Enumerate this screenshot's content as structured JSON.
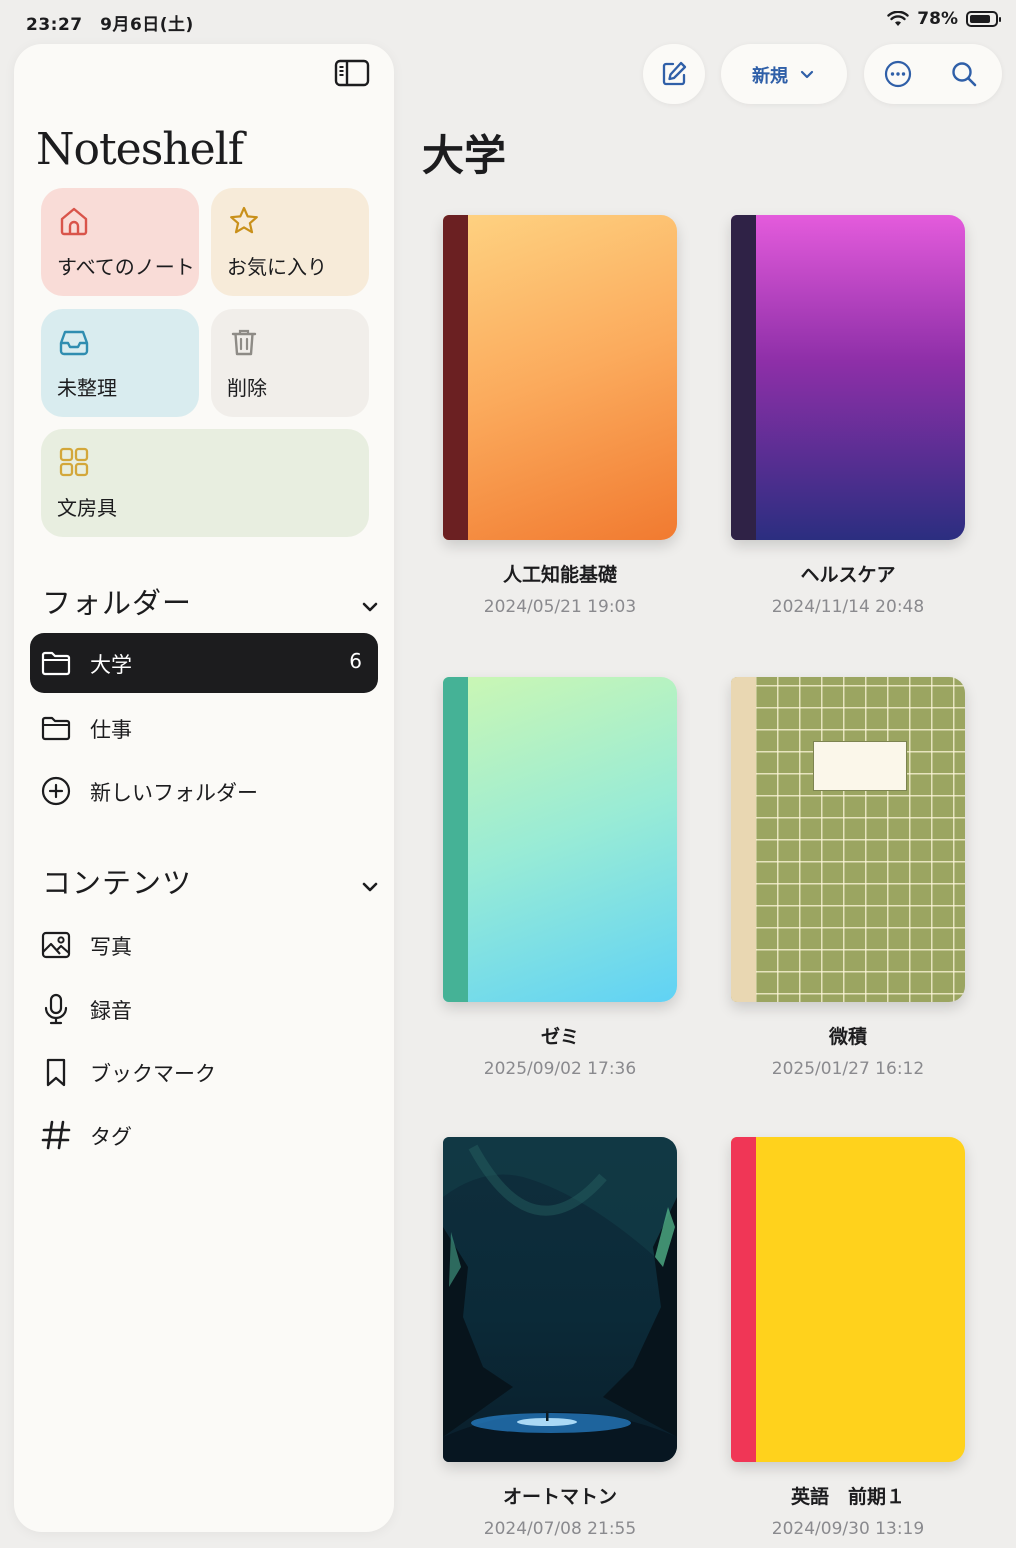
{
  "status_bar": {
    "time": "23:27　9月6日(土)",
    "battery": "78%"
  },
  "sidebar": {
    "app_title": "Noteshelf",
    "tiles": {
      "all_notes": "すべてのノート",
      "favorites": "お気に入り",
      "unfiled": "未整理",
      "trash": "削除",
      "stationery": "文房具"
    },
    "folders_header": "フォルダー",
    "folders": [
      {
        "label": "大学",
        "count": "6",
        "selected": true
      },
      {
        "label": "仕事"
      }
    ],
    "new_folder": "新しいフォルダー",
    "content_header": "コンテンツ",
    "content_items": [
      {
        "label": "写真",
        "icon": "photo-icon"
      },
      {
        "label": "録音",
        "icon": "microphone-icon"
      },
      {
        "label": "ブックマーク",
        "icon": "bookmark-icon"
      },
      {
        "label": "タグ",
        "icon": "hashtag-icon"
      }
    ]
  },
  "toolbar": {
    "new_label": "新規"
  },
  "main": {
    "title": "大学",
    "notebooks": [
      {
        "title": "人工知能基礎",
        "date": "2024/05/21 19:03"
      },
      {
        "title": "ヘルスケア",
        "date": "2024/11/14 20:48"
      },
      {
        "title": "ゼミ",
        "date": "2025/09/02 17:36"
      },
      {
        "title": "微積",
        "date": "2025/01/27 16:12"
      },
      {
        "title": "オートマトン",
        "date": "2024/07/08 21:55"
      },
      {
        "title": "英語　前期１",
        "date": "2024/09/30 13:19"
      }
    ]
  },
  "colors": {
    "accent": "#2f5fa8",
    "selected_bg": "#1c1c1e",
    "tile_all": "#f9dcd7",
    "tile_fav": "#f7ebd9",
    "tile_unfiled": "#d9ecef",
    "tile_trash": "#f1eeea",
    "tile_stationery": "#e8eee0"
  }
}
